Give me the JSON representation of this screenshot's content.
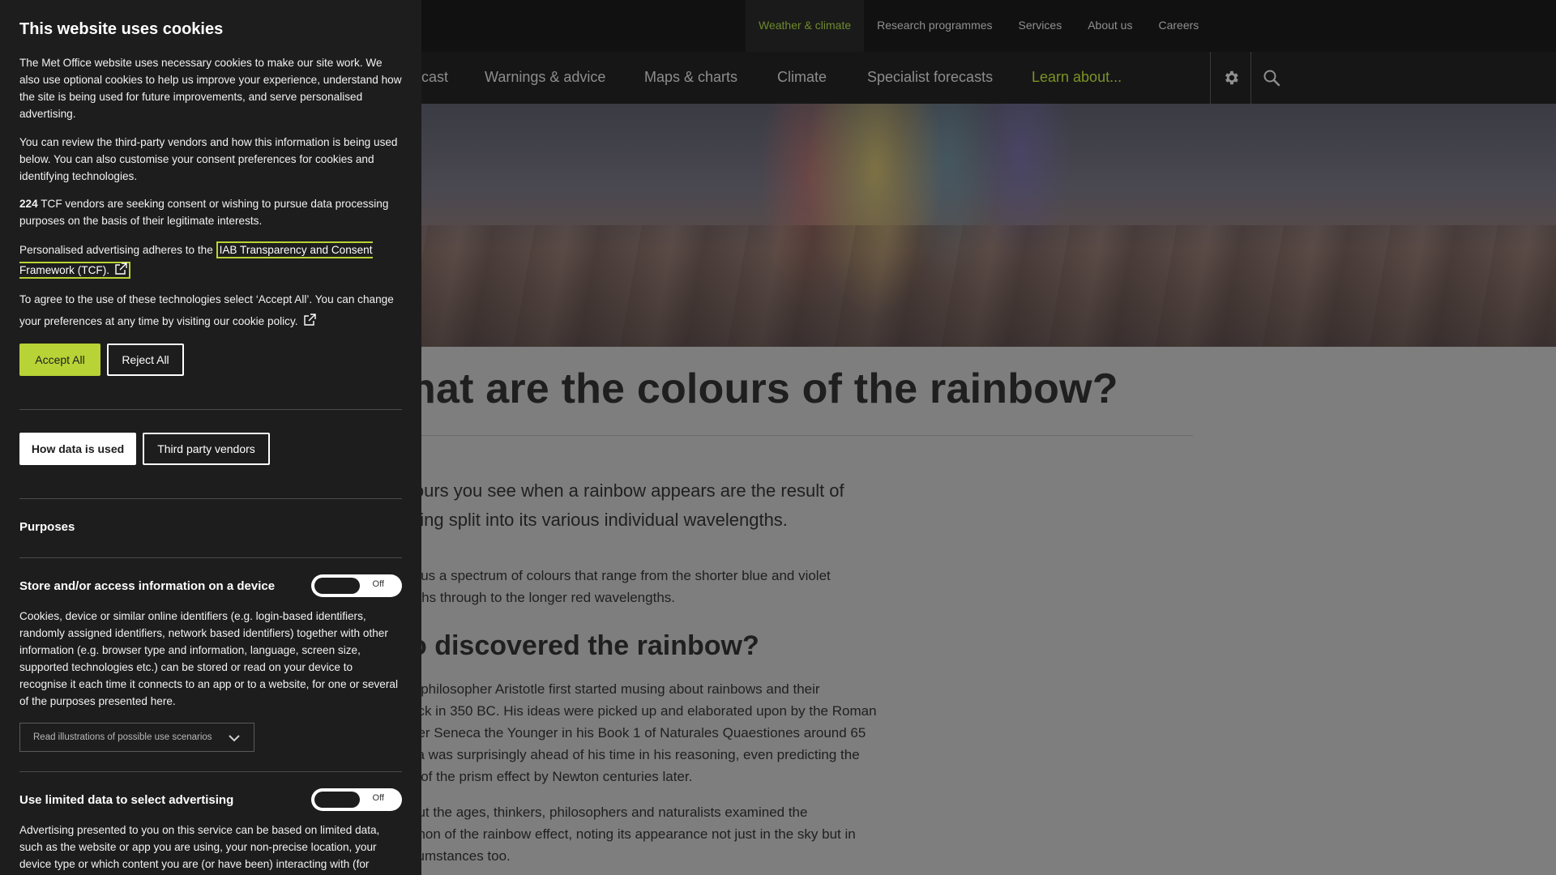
{
  "top_nav": {
    "items": [
      "Weather & climate",
      "Research programmes",
      "Services",
      "About us",
      "Careers"
    ]
  },
  "main_nav": {
    "items": [
      "cast",
      "Warnings & advice",
      "Maps & charts",
      "Climate",
      "Specialist forecasts",
      "Learn about..."
    ]
  },
  "article": {
    "title": "hat are the colours of the rainbow?",
    "lead": "lours you see when a rainbow appears are the result of\neing split into its various individual wavelengths.",
    "para1": "s us a spectrum of colours that range from the shorter blue and violet\ngths through to the longer red wavelengths.",
    "heading2": "o discovered the rainbow?",
    "para2": "k philosopher Aristotle first started musing about rainbows and their\nack in 350 BC. His ideas were picked up and elaborated upon by the Roman\nher Seneca the Younger in his Book 1 of Naturales Quaestiones around 65\nca was surprisingly ahead of his time in his reasoning, even predicting the\ny of the prism effect by Newton centuries later.",
    "para3": "out the ages, thinkers, philosophers and naturalists examined the\nenon of the rainbow effect, noting its appearance not just in the sky but in\ncumstances too."
  },
  "cookie": {
    "title": "This website uses cookies",
    "p1": "The Met Office website uses necessary cookies to make our site work. We also use optional cookies to help us improve your experience, understand how the site is being used for future improvements, and serve personalised advertising.",
    "p2": "You can review the third-party vendors and how this information is being used below. You can also customise your consent preferences for cookies and identifying technologies.",
    "vendor_count": "224",
    "p3_rest": " TCF vendors are seeking consent or wishing to pursue data processing purposes on the basis of their legitimate interests.",
    "p4_prefix": "Personalised advertising adheres to the ",
    "iab_link": "IAB Transparency and Consent Framework (TCF).",
    "p5": "To agree to the use of these technologies select ‘Accept All’. You can change your preferences at any time by visiting our cookie policy.",
    "accept_label": "Accept All",
    "reject_label": "Reject All",
    "how_label": "How data is used",
    "vendors_label": "Third party vendors",
    "purposes_heading": "Purposes",
    "purpose1_title": "Store and/or access information on a device",
    "purpose1_toggle": "Off",
    "purpose1_desc": "Cookies, device or similar online identifiers (e.g. login-based identifiers, randomly assigned identifiers, network based identifiers) together with other information (e.g. browser type and information, language, screen size, supported technologies etc.) can be stored or read on your device to recognise it each time it connects to an app or to a website, for one or several of the purposes presented here.",
    "scenario_label": "Read illustrations of possible use scenarios",
    "purpose2_title": "Use limited data to select advertising",
    "purpose2_toggle": "Off",
    "purpose2_desc": "Advertising presented to you on this service can be based on limited data, such as the website or app you are using, your non-precise location, your device type or which content you are (or have been) interacting with (for"
  },
  "colors": {
    "accent": "#b8d335",
    "panel_bg": "#1d1d1d",
    "nav_active": "#6e8a2c"
  },
  "icons": [
    "settings-gear-icon",
    "search-icon",
    "external-link-icon",
    "chevron-down-icon"
  ]
}
